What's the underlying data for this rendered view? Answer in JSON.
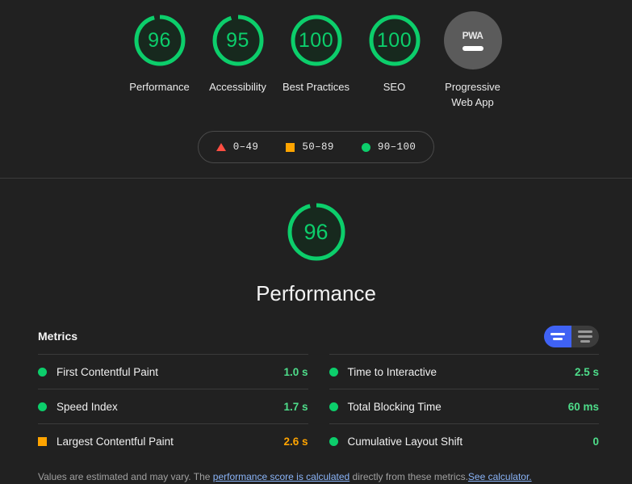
{
  "scores": {
    "items": [
      {
        "value": "96",
        "label": "Performance",
        "pct": 96,
        "state": "pass",
        "type": "gauge"
      },
      {
        "value": "95",
        "label": "Accessibility",
        "pct": 95,
        "state": "pass",
        "type": "gauge"
      },
      {
        "value": "100",
        "label": "Best Practices",
        "pct": 100,
        "state": "pass",
        "type": "gauge"
      },
      {
        "value": "100",
        "label": "SEO",
        "pct": 100,
        "state": "pass",
        "type": "gauge"
      },
      {
        "value": "PWA",
        "label": "Progressive Web App",
        "pct": 0,
        "state": "none",
        "type": "badge"
      }
    ]
  },
  "legend": {
    "items": [
      {
        "shape": "triangle-icon",
        "range": "0–49",
        "color": "#ff4e42"
      },
      {
        "shape": "square-icon",
        "range": "50–89",
        "color": "#ffa400"
      },
      {
        "shape": "circle-icon",
        "range": "90–100",
        "color": "#0cce6b"
      }
    ]
  },
  "category": {
    "score": "96",
    "pct": 96,
    "title": "Performance",
    "color": "#0cce6b"
  },
  "metrics": {
    "title": "Metrics",
    "toggle": {
      "simple_label": "Simple view",
      "expanded_label": "Expanded view",
      "active": "simple"
    },
    "left": [
      {
        "name": "First Contentful Paint",
        "value": "1.0 s",
        "state": "pass",
        "marker": "circle-icon"
      },
      {
        "name": "Speed Index",
        "value": "1.7 s",
        "state": "pass",
        "marker": "circle-icon"
      },
      {
        "name": "Largest Contentful Paint",
        "value": "2.6 s",
        "state": "average",
        "marker": "square-icon"
      }
    ],
    "right": [
      {
        "name": "Time to Interactive",
        "value": "2.5 s",
        "state": "pass",
        "marker": "circle-icon"
      },
      {
        "name": "Total Blocking Time",
        "value": "60 ms",
        "state": "pass",
        "marker": "circle-icon"
      },
      {
        "name": "Cumulative Layout Shift",
        "value": "0",
        "state": "pass",
        "marker": "circle-icon"
      }
    ]
  },
  "disclaimer": {
    "part1": "Values are estimated and may vary. The ",
    "link1": "performance score is calculated",
    "part2": " directly from these metrics.",
    "link2": "See calculator."
  }
}
